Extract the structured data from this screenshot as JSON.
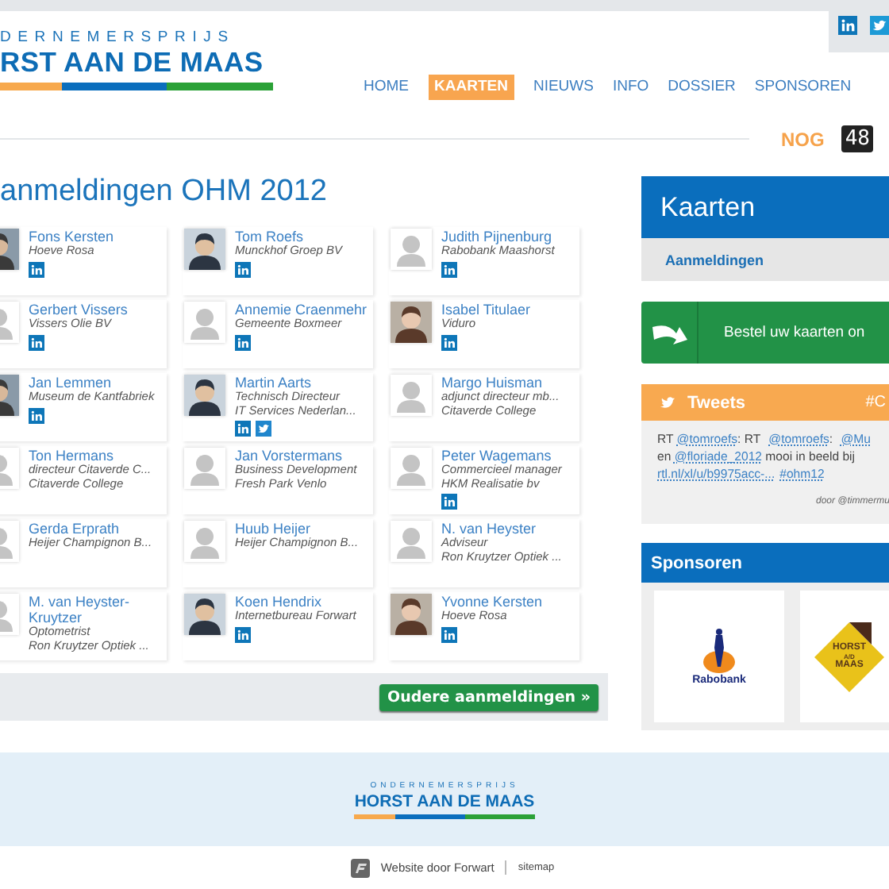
{
  "header": {
    "logo": {
      "tagline": "DERNEMERSPRIJS",
      "title": "RST AAN DE MAAS"
    },
    "nav": [
      {
        "label": "HOME",
        "selected": false
      },
      {
        "label": "KAARTEN",
        "selected": true
      },
      {
        "label": "NIEUWS",
        "selected": false
      },
      {
        "label": "INFO",
        "selected": false
      },
      {
        "label": "DOSSIER",
        "selected": false
      },
      {
        "label": "SPONSOREN",
        "selected": false
      }
    ],
    "countdown": {
      "label": "NOG",
      "value": "48"
    }
  },
  "registrations": {
    "title": "anmeldingen OHM 2012",
    "people": [
      {
        "name": "Fons Kersten",
        "lines": [
          "Hoeve Rosa"
        ],
        "linkedin": true,
        "twitter": false
      },
      {
        "name": "Tom Roefs",
        "lines": [
          "Munckhof Groep BV"
        ],
        "linkedin": true,
        "twitter": false
      },
      {
        "name": "Judith Pijnenburg",
        "lines": [
          "Rabobank Maashorst"
        ],
        "kind": "placeholder",
        "linkedin": true,
        "twitter": false
      },
      {
        "name": "Gerbert Vissers",
        "lines": [
          "Vissers Olie BV"
        ],
        "kind": "placeholder",
        "linkedin": true,
        "twitter": false
      },
      {
        "name": "Annemie Craenmehr",
        "lines": [
          "Gemeente Boxmeer"
        ],
        "kind": "placeholder",
        "linkedin": true,
        "twitter": false
      },
      {
        "name": "Isabel Titulaer",
        "lines": [
          "Viduro"
        ],
        "linkedin": true,
        "twitter": false
      },
      {
        "name": "Jan Lemmen",
        "lines": [
          "Museum de Kantfabriek"
        ],
        "linkedin": true,
        "twitter": false
      },
      {
        "name": "Martin Aarts",
        "lines": [
          "Technisch Directeur",
          "IT Services Nederlan..."
        ],
        "linkedin": true,
        "twitter": true
      },
      {
        "name": "Margo Huisman",
        "lines": [
          "adjunct directeur mb...",
          "Citaverde College"
        ],
        "kind": "placeholder",
        "linkedin": false,
        "twitter": false
      },
      {
        "name": "Ton Hermans",
        "lines": [
          "directeur Citaverde C...",
          "Citaverde College"
        ],
        "kind": "placeholder",
        "linkedin": false,
        "twitter": false
      },
      {
        "name": "Jan Vorstermans",
        "lines": [
          "Business Development",
          "Fresh Park Venlo"
        ],
        "kind": "placeholder",
        "linkedin": false,
        "twitter": false
      },
      {
        "name": "Peter Wagemans",
        "lines": [
          "Commercieel manager",
          "HKM Realisatie bv"
        ],
        "kind": "placeholder",
        "linkedin": true,
        "twitter": false
      },
      {
        "name": "Gerda Erprath",
        "lines": [
          "Heijer Champignon B..."
        ],
        "kind": "placeholder",
        "linkedin": false,
        "twitter": false
      },
      {
        "name": "Huub Heijer",
        "lines": [
          "Heijer Champignon B..."
        ],
        "kind": "placeholder",
        "linkedin": false,
        "twitter": false
      },
      {
        "name": "N. van Heyster",
        "lines": [
          "Adviseur",
          "Ron Kruytzer Optiek ..."
        ],
        "kind": "placeholder",
        "linkedin": false,
        "twitter": false
      },
      {
        "name": "M. van Heyster-Kruytzer",
        "lines": [
          "Optometrist",
          "Ron Kruytzer Optiek ..."
        ],
        "kind": "placeholder",
        "linkedin": false,
        "twitter": false
      },
      {
        "name": "Koen Hendrix",
        "lines": [
          "Internetbureau Forwart"
        ],
        "linkedin": true,
        "twitter": false
      },
      {
        "name": "Yvonne Kersten",
        "lines": [
          "Hoeve Rosa"
        ],
        "linkedin": true,
        "twitter": false
      }
    ],
    "more_button": "Oudere aanmeldingen »"
  },
  "sidebar": {
    "tickets": {
      "title": "Kaarten",
      "link": "Aanmeldingen"
    },
    "order_button": "Bestel uw kaarten on",
    "tweets": {
      "title": "Tweets",
      "hashtag": "#C",
      "lines": [
        [
          {
            "kind": "text",
            "text": "RT "
          },
          {
            "kind": "link",
            "text": "@tomroefs"
          },
          {
            "kind": "text",
            "text": ": RT "
          },
          {
            "kind": "link",
            "text": "@tomroefs"
          },
          {
            "kind": "text",
            "text": ": "
          },
          {
            "kind": "link",
            "text": "@Mu"
          }
        ],
        [
          {
            "kind": "text",
            "text": "en "
          },
          {
            "kind": "link",
            "text": "@floriade_2012"
          },
          {
            "kind": "text",
            "text": " mooi in beeld bij"
          }
        ],
        [
          {
            "kind": "link",
            "text": "rtl.nl/xl/u/b9975acc-..."
          },
          {
            "kind": "link",
            "text": "#ohm12"
          }
        ]
      ],
      "byline": "door @timmermu"
    },
    "sponsors": {
      "title": "Sponsoren",
      "items": [
        {
          "kind": "rabobank",
          "text": "Rabobank"
        },
        {
          "kind": "horst",
          "text": "HORST",
          "small": "A/D",
          "text2": "MAAS"
        }
      ]
    }
  },
  "footer": {
    "logo": {
      "tagline": "ONDERNEMERSPRIJS",
      "title": "HORST AAN DE MAAS"
    },
    "credit": "Website door Forwart",
    "sitemap": "sitemap"
  }
}
